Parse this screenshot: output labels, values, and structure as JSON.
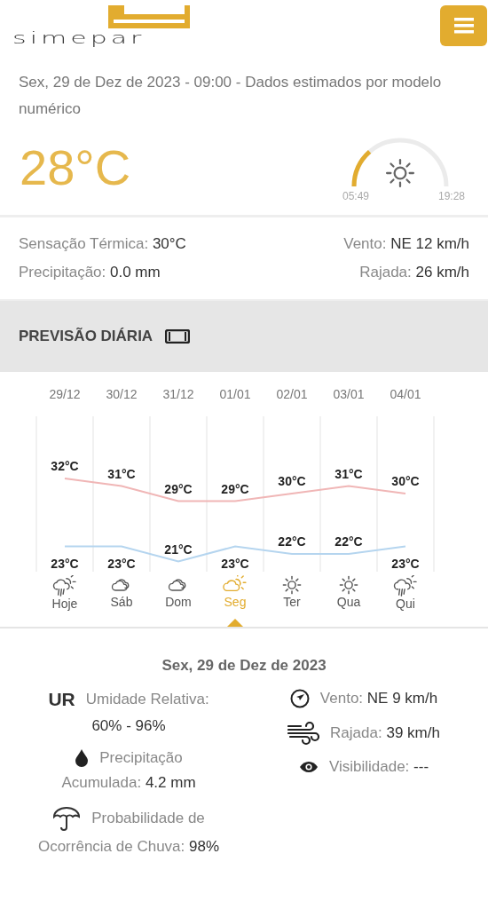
{
  "header": {
    "logo": "simepar"
  },
  "current": {
    "subtitle": "Sex, 29 de Dez de 2023 - 09:00 - Dados estimados por modelo numérico",
    "temperature": "28°C",
    "sunrise": "05:49",
    "sunset": "19:28"
  },
  "conditions": {
    "left": [
      {
        "label": "Sensação Térmica:",
        "value": "30°C"
      },
      {
        "label": "Precipitação:",
        "value": "0.0 mm"
      }
    ],
    "right": [
      {
        "label": "Vento:",
        "value": "NE 12 km/h"
      },
      {
        "label": "Rajada:",
        "value": "26 km/h"
      }
    ]
  },
  "daily": {
    "title": "PREVISÃO DIÁRIA",
    "chart_data": {
      "type": "line",
      "categories": [
        "29/12",
        "30/12",
        "31/12",
        "01/01",
        "02/01",
        "03/01",
        "04/01"
      ],
      "data_labels": true,
      "series": [
        {
          "color": "#f0b6b6",
          "values": [
            32,
            31,
            29,
            29,
            30,
            31,
            30
          ],
          "value_labels": [
            "32°C",
            "31°C",
            "29°C",
            "29°C",
            "30°C",
            "31°C",
            "30°C"
          ]
        },
        {
          "color": "#b5d5ef",
          "values": [
            23,
            23,
            21,
            23,
            22,
            22,
            23
          ],
          "value_labels": [
            "23°C",
            "23°C",
            "21°C",
            "23°C",
            "22°C",
            "22°C",
            "23°C"
          ]
        }
      ]
    },
    "days": [
      {
        "name": "Hoje",
        "kind": "rain",
        "selected": false
      },
      {
        "name": "Sáb",
        "kind": "cloud",
        "selected": false
      },
      {
        "name": "Dom",
        "kind": "cloud",
        "selected": false
      },
      {
        "name": "Seg",
        "kind": "partly",
        "selected": true
      },
      {
        "name": "Ter",
        "kind": "sun",
        "selected": false
      },
      {
        "name": "Qua",
        "kind": "sun",
        "selected": false
      },
      {
        "name": "Qui",
        "kind": "rain",
        "selected": false
      }
    ]
  },
  "detail": {
    "title": "Sex, 29 de Dez de 2023",
    "left": [
      {
        "kind": "ur",
        "badge": "UR",
        "label": "Umidade Relativa:",
        "value": "60% - 96%"
      },
      {
        "kind": "drop",
        "label": "Precipitação",
        "label_2": "Acumulada:",
        "value": "4.2 mm"
      },
      {
        "kind": "umbrella",
        "label": "Probabilidade de",
        "label_2": "Ocorrência de Chuva:",
        "value": "98%"
      }
    ],
    "right": [
      {
        "kind": "compass",
        "label": "Vento:",
        "value": "NE 9 km/h"
      },
      {
        "kind": "wind",
        "label": "Rajada:",
        "value": "39 km/h"
      },
      {
        "kind": "eye",
        "label": "Visibilidade:",
        "value": "---"
      }
    ]
  }
}
